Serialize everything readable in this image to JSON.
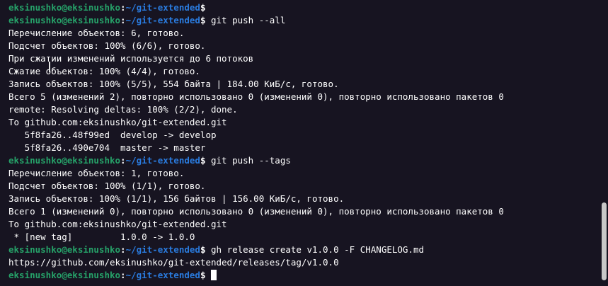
{
  "window": {
    "title": "eksinushko@eksinushko:~/git-extended"
  },
  "prompt": {
    "user_host": "eksinushko@eksinushko",
    "separator": ":",
    "path": "~/git-extended",
    "symbol": "$"
  },
  "colors": {
    "background": "#171421",
    "prompt_user": "#26a269",
    "prompt_path": "#2a7bde",
    "text": "#ffffff"
  },
  "lines": [
    {
      "type": "prompt",
      "command": ""
    },
    {
      "type": "prompt",
      "command": " git push --all"
    },
    {
      "type": "output",
      "text": "Перечисление объектов: 6, готово."
    },
    {
      "type": "output",
      "text": "Подсчет объектов: 100% (6/6), готово."
    },
    {
      "type": "output",
      "text": "При сжатии изменений используется до 6 потоков"
    },
    {
      "type": "output",
      "text": "Сжатие объектов: 100% (4/4), готово."
    },
    {
      "type": "output",
      "text": "Запись объектов: 100% (5/5), 554 байта | 184.00 КиБ/с, готово."
    },
    {
      "type": "output",
      "text": "Всего 5 (изменений 2), повторно использовано 0 (изменений 0), повторно использовано пакетов 0"
    },
    {
      "type": "output",
      "text": "remote: Resolving deltas: 100% (2/2), done."
    },
    {
      "type": "output",
      "text": "To github.com:eksinushko/git-extended.git"
    },
    {
      "type": "output",
      "text": "   5f8fa26..48f99ed  develop -> develop"
    },
    {
      "type": "output",
      "text": "   5f8fa26..490e704  master -> master"
    },
    {
      "type": "prompt",
      "command": " git push --tags"
    },
    {
      "type": "output",
      "text": "Перечисление объектов: 1, готово."
    },
    {
      "type": "output",
      "text": "Подсчет объектов: 100% (1/1), готово."
    },
    {
      "type": "output",
      "text": "Запись объектов: 100% (1/1), 156 байтов | 156.00 КиБ/с, готово."
    },
    {
      "type": "output",
      "text": "Всего 1 (изменений 0), повторно использовано 0 (изменений 0), повторно использовано пакетов 0"
    },
    {
      "type": "output",
      "text": "To github.com:eksinushko/git-extended.git"
    },
    {
      "type": "output",
      "text": " * [new tag]         1.0.0 -> 1.0.0"
    },
    {
      "type": "prompt",
      "command": " gh release create v1.0.0 -F CHANGELOG.md"
    },
    {
      "type": "output",
      "text": "https://github.com/eksinushko/git-extended/releases/tag/v1.0.0"
    },
    {
      "type": "prompt",
      "command": " ",
      "cursor": true
    }
  ],
  "icons": {
    "cursor": "text-cursor-block",
    "mouse": "ibeam-cursor-icon"
  }
}
